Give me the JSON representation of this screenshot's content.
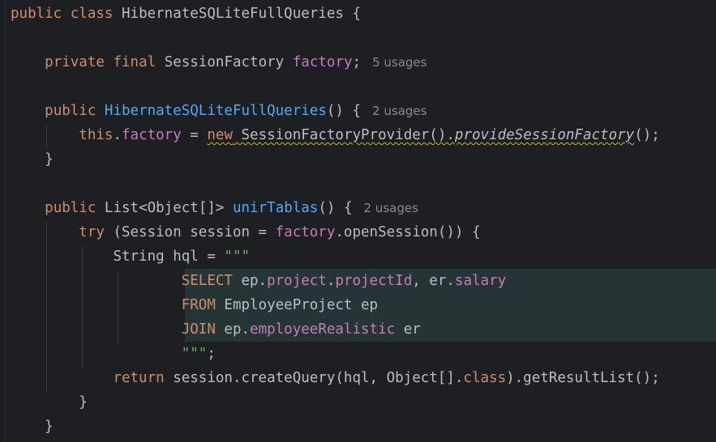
{
  "code": {
    "l1": {
      "kw_public": "public",
      "kw_class": "class",
      "class_name": "HibernateSQLiteFullQueries",
      "brace": "{"
    },
    "l2": {
      "kw_private": "private",
      "kw_final": "final",
      "type": "SessionFactory",
      "field": "factory",
      "semi": ";",
      "hint": "5 usages"
    },
    "l3": {
      "kw_public": "public",
      "ctor_name": "HibernateSQLiteFullQueries",
      "rest": "() {",
      "hint": "2 usages"
    },
    "l4": {
      "kw_this": "this",
      "dot": ".",
      "field": "factory",
      "eq": " = ",
      "kw_new": "new",
      "ctor_call": " SessionFactoryProvider().",
      "method": "provideSessionFactory",
      "end": "();"
    },
    "l5": {
      "brace": "}"
    },
    "l6": {
      "kw_public": "public",
      "type": "List<Object[]>",
      "method": "unirTablas",
      "rest": "() {",
      "hint": "2 usages"
    },
    "l7": {
      "kw_try": "try",
      "open": " (Session session = ",
      "field": "factory",
      "rest": ".openSession()) {"
    },
    "l8": {
      "text": "String hql = ",
      "str": "\"\"\""
    },
    "l9": {
      "kw": "SELECT",
      "a": " ep.",
      "f1": "project",
      "b": ".",
      "f2": "projectId",
      "c": ", er.",
      "f3": "salary"
    },
    "l10": {
      "kw": "FROM",
      "a": " EmployeeProject ep"
    },
    "l11": {
      "kw": "JOIN",
      "a": " ep.",
      "f1": "employeeRealistic",
      "b": " er"
    },
    "l12": {
      "str": "\"\"\"",
      "semi": ";"
    },
    "l13": {
      "kw_return": "return",
      "a": " session.createQuery(hql, Object[].",
      "kw_class": "class",
      "b": ").getResultList();"
    },
    "l14": {
      "brace": "}"
    },
    "l15": {
      "brace": "}"
    }
  }
}
